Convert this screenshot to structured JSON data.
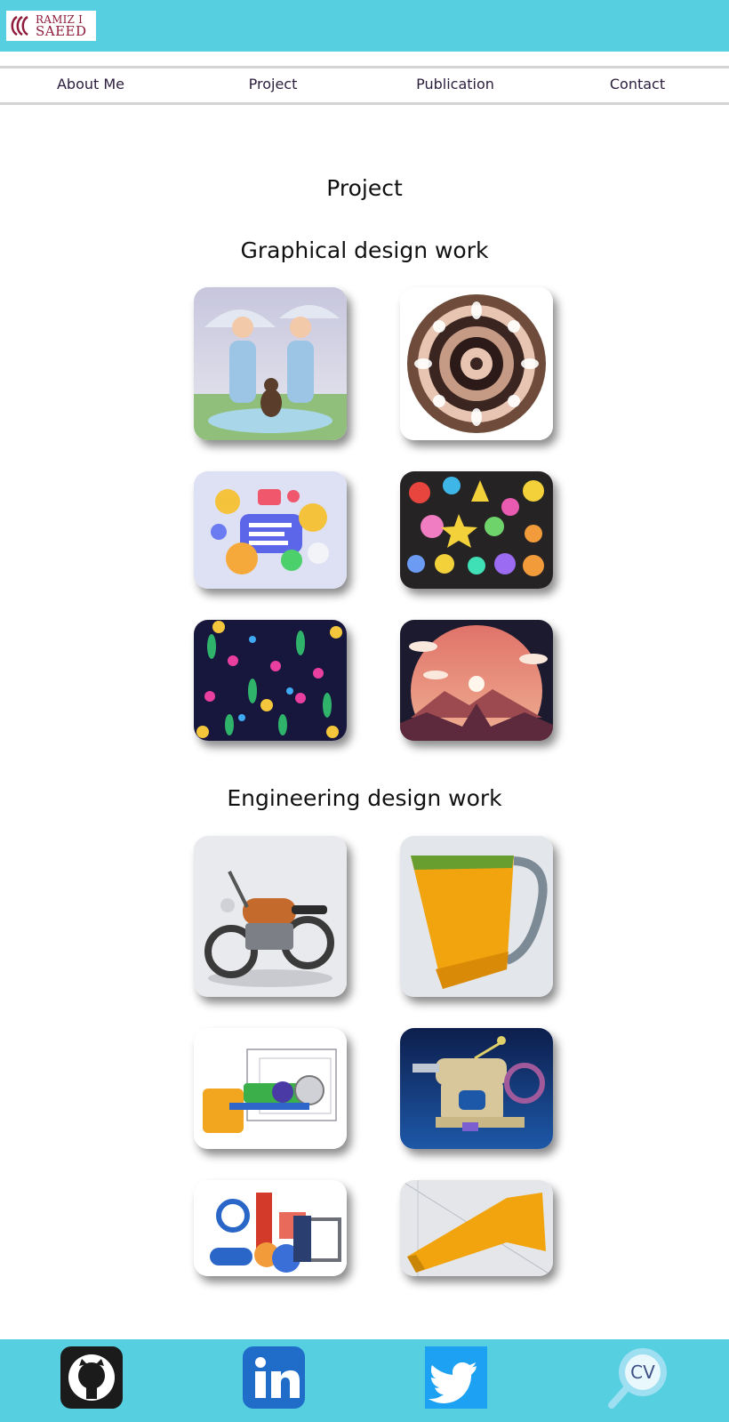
{
  "header": {
    "logo_line1": "RAMIZ I",
    "logo_line2": "SAEED"
  },
  "nav": {
    "items": [
      {
        "label": "About Me"
      },
      {
        "label": "Project"
      },
      {
        "label": "Publication"
      },
      {
        "label": "Contact"
      }
    ]
  },
  "main": {
    "title": "Project",
    "sections": [
      {
        "title": "Graphical design work"
      },
      {
        "title": "Engineering design work"
      }
    ]
  },
  "footer": {
    "cv_label": "CV"
  },
  "colors": {
    "brand": "#56cfe1",
    "logo": "#8e1b3a",
    "nav_text": "#2b1d3c"
  },
  "icons": [
    "github-icon",
    "linkedin-icon",
    "twitter-icon",
    "cv-search-icon"
  ]
}
